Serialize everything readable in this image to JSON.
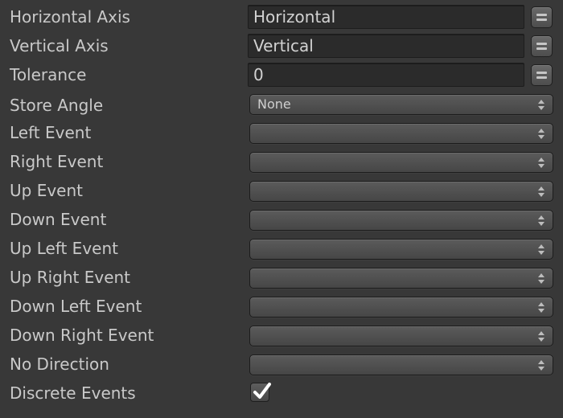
{
  "fields": {
    "horizontal_axis": {
      "label": "Horizontal Axis",
      "value": "Horizontal"
    },
    "vertical_axis": {
      "label": "Vertical Axis",
      "value": "Vertical"
    },
    "tolerance": {
      "label": "Tolerance",
      "value": "0"
    },
    "store_angle": {
      "label": "Store Angle",
      "value": "None"
    },
    "left_event": {
      "label": "Left Event",
      "value": ""
    },
    "right_event": {
      "label": "Right Event",
      "value": ""
    },
    "up_event": {
      "label": "Up Event",
      "value": ""
    },
    "down_event": {
      "label": "Down Event",
      "value": ""
    },
    "up_left_event": {
      "label": "Up Left Event",
      "value": ""
    },
    "up_right_event": {
      "label": "Up Right Event",
      "value": ""
    },
    "down_left_event": {
      "label": "Down Left Event",
      "value": ""
    },
    "down_right_event": {
      "label": "Down Right Event",
      "value": ""
    },
    "no_direction": {
      "label": "No Direction",
      "value": ""
    },
    "discrete_events": {
      "label": "Discrete Events",
      "checked": true
    }
  },
  "icons": {
    "variable_toggle": "equals-icon",
    "dropdown_arrows": "updown-arrows-icon",
    "check": "checkmark-icon"
  },
  "colors": {
    "background": "#383838",
    "field_bg": "#2b2b2b",
    "text": "#c9c9c9"
  }
}
